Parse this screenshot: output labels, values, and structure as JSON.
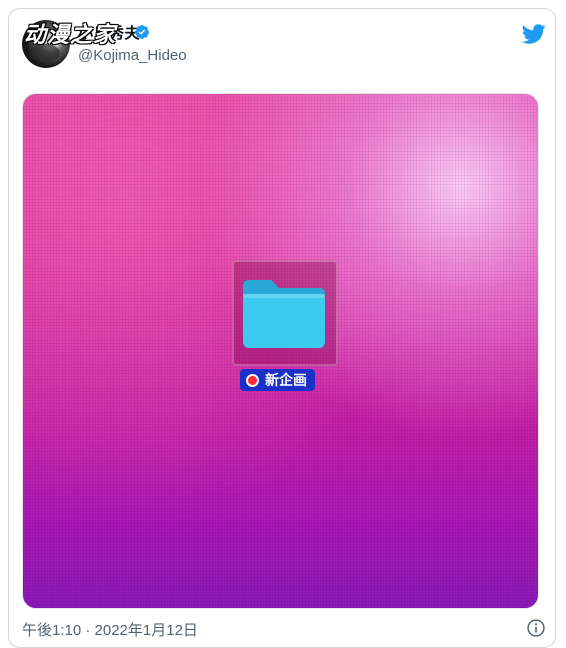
{
  "tweet": {
    "display_name": "小島秀夫",
    "watermark": "动漫之家",
    "handle": "@Kojima_Hideo",
    "timestamp": "午後1:10 · 2022年1月12日"
  },
  "media": {
    "folder_label": "新企画",
    "tag_color": "#ff2a3a",
    "folder_color": "#35c8ea"
  },
  "icons": {
    "verified": "verified-badge-icon",
    "twitter": "twitter-bird-icon",
    "info": "info-icon"
  },
  "colors": {
    "twitter_blue": "#1d9bf0",
    "muted_text": "#536471"
  }
}
